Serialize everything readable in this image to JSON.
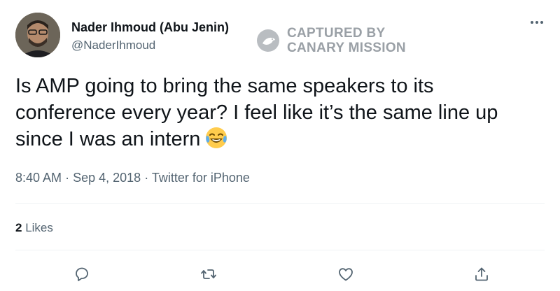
{
  "author": {
    "display_name": "Nader Ihmoud (Abu Jenin)",
    "handle": "@NaderIhmoud"
  },
  "watermark": {
    "line1": "CAPTURED BY",
    "line2": "CANARY MISSION"
  },
  "tweet": {
    "text_line1": "Is AMP going to bring the same speakers to its",
    "text_line2": "conference every year? I feel like it’s the same line up",
    "text_line3": "since I was an intern",
    "emoji": "face-with-tears-of-joy",
    "time": "8:40 AM",
    "date": "Sep 4, 2018",
    "source": "Twitter for iPhone",
    "separator": "·"
  },
  "engagement": {
    "likes_count": "2",
    "likes_label": "Likes"
  },
  "actions": {
    "reply_icon": "reply-icon",
    "retweet_icon": "retweet-icon",
    "like_icon": "like-icon",
    "share_icon": "share-icon"
  },
  "colors": {
    "text": "#0f1419",
    "secondary": "#536471",
    "watermark": "#9aa0a6",
    "divider": "#eff3f4"
  }
}
